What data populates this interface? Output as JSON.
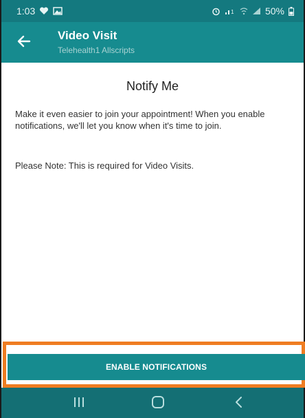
{
  "status_bar": {
    "time": "1:03",
    "battery": "50%"
  },
  "app_bar": {
    "title": "Video Visit",
    "subtitle": "Telehealth1 Allscripts"
  },
  "content": {
    "heading": "Notify Me",
    "body": "Make it even easier to join your appointment! When you enable notifications, we'll let you know when it's time to join.",
    "note": "Please Note: This is required for Video Visits."
  },
  "button": {
    "label": "ENABLE NOTIFICATIONS"
  },
  "colors": {
    "status_bar": "#14797f",
    "app_bar": "#168b8f",
    "button": "#168b8f",
    "nav_bar": "#146f74",
    "highlight": "#ef7d22"
  },
  "icons": {
    "status_left": [
      "heart-icon",
      "image-icon"
    ],
    "status_right": [
      "alarm-icon",
      "signal-icon",
      "wifi-icon",
      "cell-signal-icon",
      "battery-icon"
    ],
    "nav": [
      "recent-apps-icon",
      "home-icon",
      "back-nav-icon"
    ]
  }
}
